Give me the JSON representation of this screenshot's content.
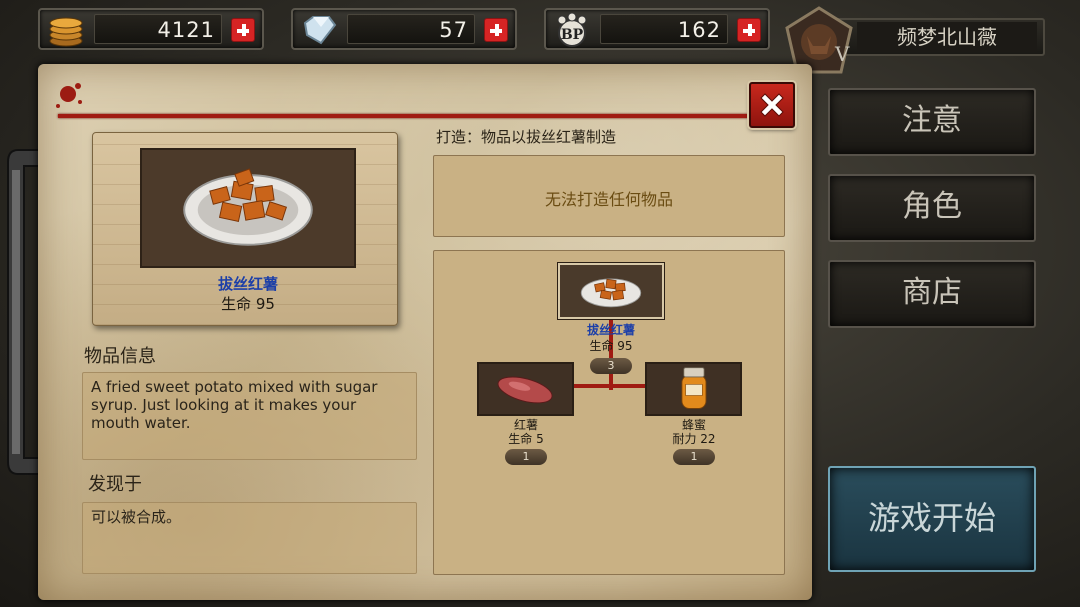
{
  "top_bar": {
    "coins": "4121",
    "diamonds": "57",
    "bp_points": "162",
    "bp_label": "BP"
  },
  "player": {
    "name": "频梦北山薇",
    "rank": "V"
  },
  "item": {
    "name": "拔丝红薯",
    "stat": "生命 95",
    "info_title": "物品信息",
    "description": "A fried sweet potato mixed with sugar syrup. Just looking at it makes your mouth water.",
    "found_title": "发现于",
    "found_text": "可以被合成。"
  },
  "crafting": {
    "title": "打造：物品以拔丝红薯制造",
    "message": "无法打造任何物品",
    "result": {
      "name": "拔丝红薯",
      "stat": "生命 95",
      "count": "3"
    },
    "ingredients": [
      {
        "name": "红薯",
        "stat": "生命 5",
        "count": "1"
      },
      {
        "name": "蜂蜜",
        "stat": "耐力 22",
        "count": "1"
      }
    ]
  },
  "menu": {
    "notice": "注意",
    "character": "角色",
    "shop": "商店",
    "start_game": "游戏开始"
  },
  "colors": {
    "accent_red": "#a01b12",
    "item_name_blue": "#1c3fa8",
    "start_button": "#2a4d5c"
  }
}
